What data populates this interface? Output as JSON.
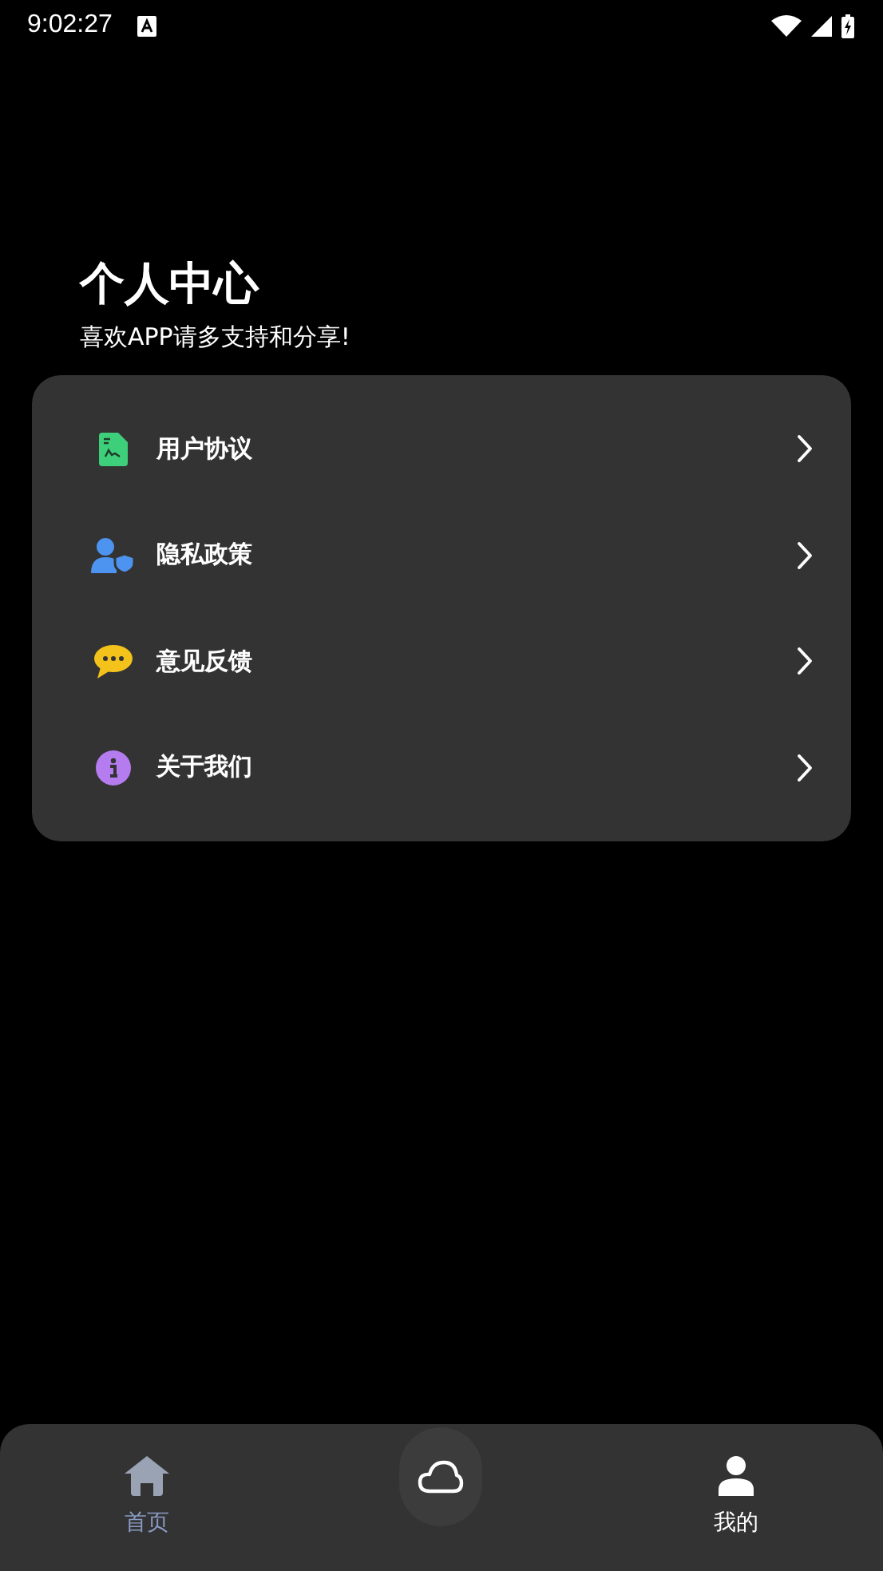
{
  "status_bar": {
    "time": "9:02:27"
  },
  "header": {
    "title": "个人中心",
    "subtitle": "喜欢APP请多支持和分享!"
  },
  "menu": [
    {
      "kind": "document",
      "label": "用户协议"
    },
    {
      "kind": "privacy",
      "label": "隐私政策"
    },
    {
      "kind": "feedback",
      "label": "意见反馈"
    },
    {
      "kind": "about",
      "label": "关于我们"
    }
  ],
  "bottom_nav": [
    {
      "kind": "home",
      "label": "首页",
      "selected": false
    },
    {
      "kind": "profile",
      "label": "我的",
      "selected": true
    }
  ]
}
